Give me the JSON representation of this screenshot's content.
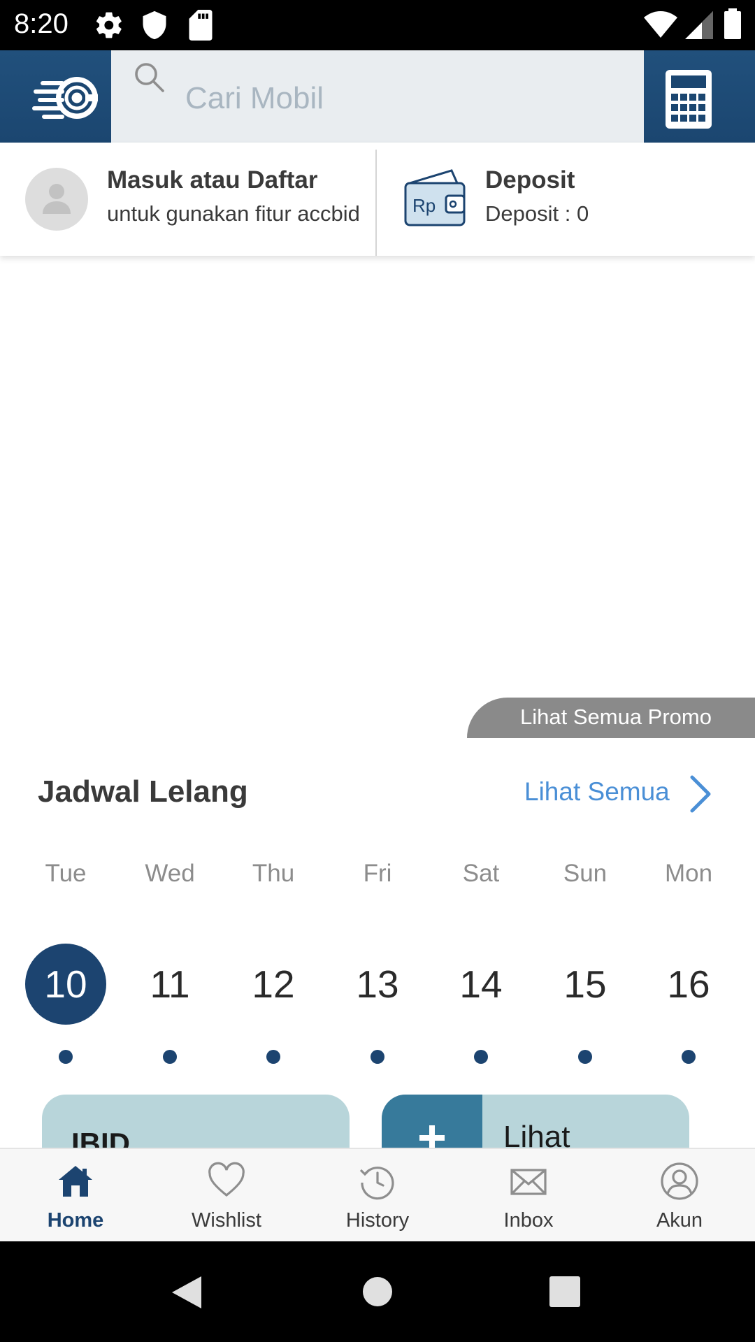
{
  "status_bar": {
    "time": "8:20",
    "icons": [
      "gear-icon",
      "shield-icon",
      "sd-card-icon",
      "wifi-icon",
      "signal-icon",
      "battery-icon"
    ]
  },
  "header": {
    "logo": "accbid-logo-icon",
    "search_placeholder": "Cari Mobil",
    "calculator_icon": "calculator-icon",
    "background_color": "#1b4670"
  },
  "account": {
    "login_title": "Masuk atau Daftar",
    "login_subtitle": "untuk gunakan fitur accbid",
    "deposit_title": "Deposit",
    "deposit_value": "Deposit : 0"
  },
  "promo": {
    "see_all_label": "Lihat Semua Promo"
  },
  "schedule": {
    "title": "Jadwal Lelang",
    "see_all_label": "Lihat Semua",
    "days": [
      {
        "day": "Tue",
        "date": "10",
        "active": true
      },
      {
        "day": "Wed",
        "date": "11",
        "active": false
      },
      {
        "day": "Thu",
        "date": "12",
        "active": false
      },
      {
        "day": "Fri",
        "date": "13",
        "active": false
      },
      {
        "day": "Sat",
        "date": "14",
        "active": false
      },
      {
        "day": "Sun",
        "date": "15",
        "active": false
      },
      {
        "day": "Mon",
        "date": "16",
        "active": false
      }
    ],
    "accent_color": "#1c4470",
    "link_color": "#4a8fd6"
  },
  "cards": {
    "ibid_label": "IBID",
    "lihat_label": "Lihat"
  },
  "bottom_nav": {
    "items": [
      {
        "label": "Home",
        "icon": "home-icon",
        "active": true
      },
      {
        "label": "Wishlist",
        "icon": "heart-icon",
        "active": false
      },
      {
        "label": "History",
        "icon": "history-icon",
        "active": false
      },
      {
        "label": "Inbox",
        "icon": "mail-icon",
        "active": false
      },
      {
        "label": "Akun",
        "icon": "account-icon",
        "active": false
      }
    ]
  }
}
